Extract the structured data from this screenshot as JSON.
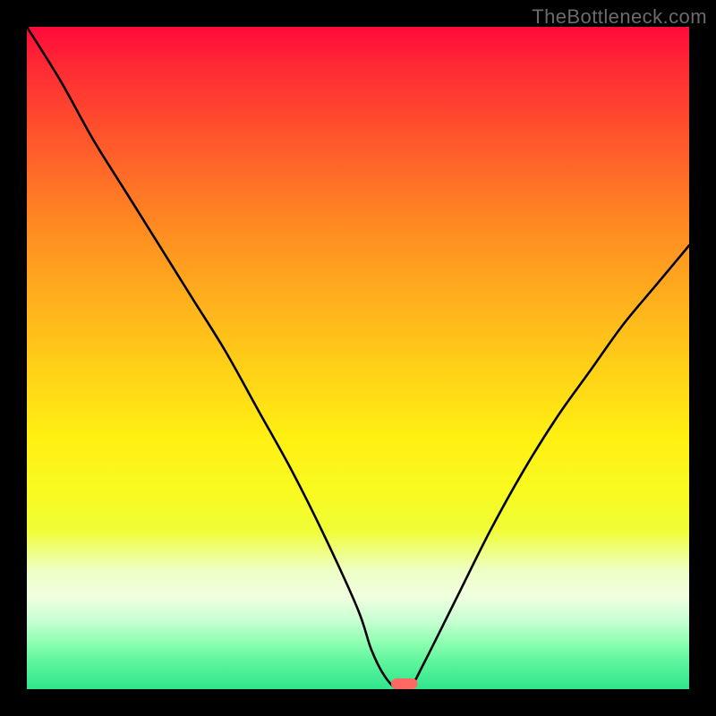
{
  "watermark": "TheBottleneck.com",
  "chart_data": {
    "type": "line",
    "title": "",
    "xlabel": "",
    "ylabel": "",
    "xlim": [
      0,
      100
    ],
    "ylim": [
      0,
      100
    ],
    "grid": false,
    "legend": false,
    "series": [
      {
        "name": "bottleneck-curve",
        "x": [
          0,
          5,
          10,
          15,
          20,
          25,
          30,
          35,
          40,
          45,
          50,
          52,
          54,
          56,
          58,
          60,
          65,
          70,
          75,
          80,
          85,
          90,
          95,
          100
        ],
        "y": [
          100,
          92,
          83,
          75,
          67,
          59,
          51,
          42,
          33,
          23,
          12,
          6,
          2,
          0,
          0.5,
          4,
          14,
          24,
          33,
          41,
          48,
          55,
          61,
          67
        ]
      }
    ],
    "marker": {
      "x_pct": 57,
      "y_pct": 0,
      "width_pct": 4,
      "color": "#ff6962"
    },
    "gradient_stops": [
      {
        "pct": 0,
        "color": "#ff0a3a"
      },
      {
        "pct": 50,
        "color": "#ffd816"
      },
      {
        "pct": 80,
        "color": "#eeff88"
      },
      {
        "pct": 100,
        "color": "#30e58c"
      }
    ]
  }
}
